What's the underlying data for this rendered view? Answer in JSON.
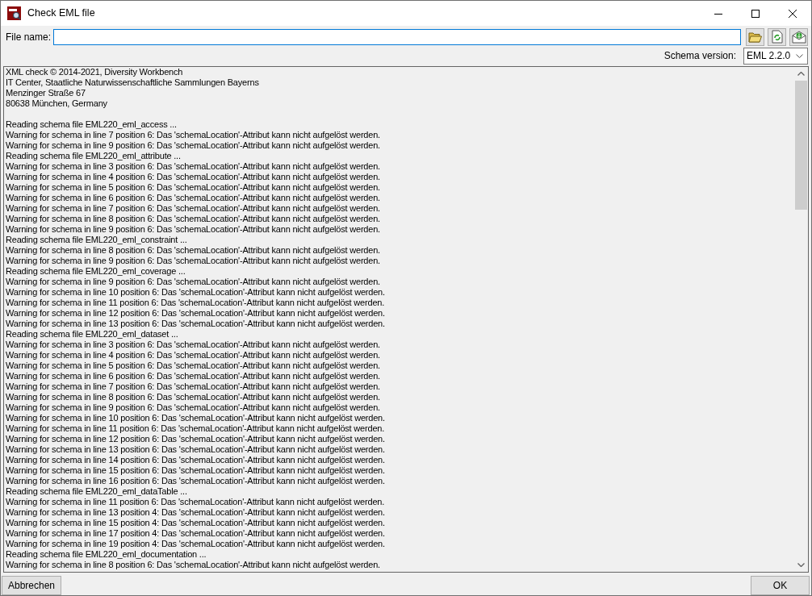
{
  "window": {
    "title": "Check EML file"
  },
  "file_name": {
    "label": "File name:"
  },
  "schema_version": {
    "label": "Schema version:",
    "value": "EML 2.2.0"
  },
  "log": {
    "header_lines": [
      "XML check © 2014-2021, Diversity Workbench",
      "IT Center, Staatliche Naturwissenschaftliche Sammlungen Bayerns",
      "Menzinger Straße 67",
      "80638 München, Germany"
    ],
    "lines": [
      "Reading schema file EML220_eml_access ...",
      "Warning for schema in line 7 position 6: Das 'schemaLocation'-Attribut kann nicht aufgelöst werden.",
      "Warning for schema in line 9 position 6: Das 'schemaLocation'-Attribut kann nicht aufgelöst werden.",
      "Reading schema file EML220_eml_attribute ...",
      "Warning for schema in line 3 position 6: Das 'schemaLocation'-Attribut kann nicht aufgelöst werden.",
      "Warning for schema in line 4 position 6: Das 'schemaLocation'-Attribut kann nicht aufgelöst werden.",
      "Warning for schema in line 5 position 6: Das 'schemaLocation'-Attribut kann nicht aufgelöst werden.",
      "Warning for schema in line 6 position 6: Das 'schemaLocation'-Attribut kann nicht aufgelöst werden.",
      "Warning for schema in line 7 position 6: Das 'schemaLocation'-Attribut kann nicht aufgelöst werden.",
      "Warning for schema in line 8 position 6: Das 'schemaLocation'-Attribut kann nicht aufgelöst werden.",
      "Warning for schema in line 9 position 6: Das 'schemaLocation'-Attribut kann nicht aufgelöst werden.",
      "Reading schema file EML220_eml_constraint ...",
      "Warning for schema in line 8 position 6: Das 'schemaLocation'-Attribut kann nicht aufgelöst werden.",
      "Warning for schema in line 9 position 6: Das 'schemaLocation'-Attribut kann nicht aufgelöst werden.",
      "Reading schema file EML220_eml_coverage ...",
      "Warning for schema in line 9 position 6: Das 'schemaLocation'-Attribut kann nicht aufgelöst werden.",
      "Warning for schema in line 10 position 6: Das 'schemaLocation'-Attribut kann nicht aufgelöst werden.",
      "Warning for schema in line 11 position 6: Das 'schemaLocation'-Attribut kann nicht aufgelöst werden.",
      "Warning for schema in line 12 position 6: Das 'schemaLocation'-Attribut kann nicht aufgelöst werden.",
      "Warning for schema in line 13 position 6: Das 'schemaLocation'-Attribut kann nicht aufgelöst werden.",
      "Reading schema file EML220_eml_dataset ...",
      "Warning for schema in line 3 position 6: Das 'schemaLocation'-Attribut kann nicht aufgelöst werden.",
      "Warning for schema in line 4 position 6: Das 'schemaLocation'-Attribut kann nicht aufgelöst werden.",
      "Warning for schema in line 5 position 6: Das 'schemaLocation'-Attribut kann nicht aufgelöst werden.",
      "Warning for schema in line 6 position 6: Das 'schemaLocation'-Attribut kann nicht aufgelöst werden.",
      "Warning for schema in line 7 position 6: Das 'schemaLocation'-Attribut kann nicht aufgelöst werden.",
      "Warning for schema in line 8 position 6: Das 'schemaLocation'-Attribut kann nicht aufgelöst werden.",
      "Warning for schema in line 9 position 6: Das 'schemaLocation'-Attribut kann nicht aufgelöst werden.",
      "Warning for schema in line 10 position 6: Das 'schemaLocation'-Attribut kann nicht aufgelöst werden.",
      "Warning for schema in line 11 position 6: Das 'schemaLocation'-Attribut kann nicht aufgelöst werden.",
      "Warning for schema in line 12 position 6: Das 'schemaLocation'-Attribut kann nicht aufgelöst werden.",
      "Warning for schema in line 13 position 6: Das 'schemaLocation'-Attribut kann nicht aufgelöst werden.",
      "Warning for schema in line 14 position 6: Das 'schemaLocation'-Attribut kann nicht aufgelöst werden.",
      "Warning for schema in line 15 position 6: Das 'schemaLocation'-Attribut kann nicht aufgelöst werden.",
      "Warning for schema in line 16 position 6: Das 'schemaLocation'-Attribut kann nicht aufgelöst werden.",
      "Reading schema file EML220_eml_dataTable ...",
      "Warning for schema in line 11 position 6: Das 'schemaLocation'-Attribut kann nicht aufgelöst werden.",
      "Warning for schema in line 13 position 4: Das 'schemaLocation'-Attribut kann nicht aufgelöst werden.",
      "Warning for schema in line 15 position 4: Das 'schemaLocation'-Attribut kann nicht aufgelöst werden.",
      "Warning for schema in line 17 position 4: Das 'schemaLocation'-Attribut kann nicht aufgelöst werden.",
      "Warning for schema in line 19 position 4: Das 'schemaLocation'-Attribut kann nicht aufgelöst werden.",
      "Reading schema file EML220_eml_documentation ...",
      "Warning for schema in line 8 position 6: Das 'schemaLocation'-Attribut kann nicht aufgelöst werden."
    ]
  },
  "buttons": {
    "cancel": "Abbrechen",
    "ok": "OK"
  }
}
